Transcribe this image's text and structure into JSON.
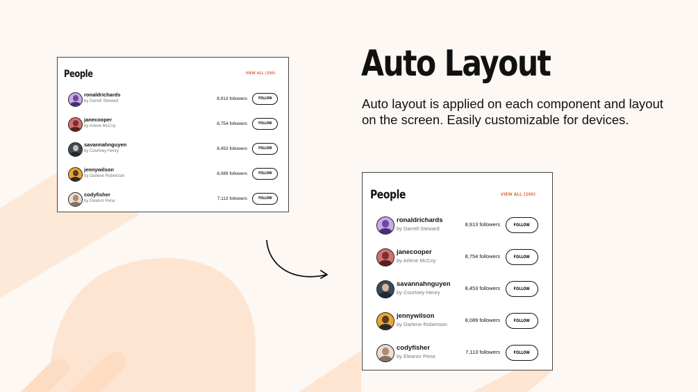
{
  "headline": "Auto Layout",
  "description": "Auto layout is applied on each component and layout on the screen. Easily customizable for devices.",
  "colors": {
    "background": "#fdf8f3",
    "accent": "#e2683c",
    "shape": "#fde5d2"
  },
  "card": {
    "title": "People",
    "view_all": "VIEW ALL (200)",
    "follow_label": "FOLLOW",
    "people": [
      {
        "username": "ronaldrichards",
        "byline": "by Darrell Steward",
        "followers": "8,913 followers",
        "avatar_bg": "#c9a9e6",
        "skin": "#6b4aa0",
        "shirt": "#4a2c7a"
      },
      {
        "username": "janecooper",
        "byline": "by Arlene McCoy",
        "followers": "8,754 followers",
        "avatar_bg": "#d47070",
        "skin": "#7a3030",
        "shirt": "#5a1e1e"
      },
      {
        "username": "savannahnguyen",
        "byline": "by Courtney Henry",
        "followers": "8,453 followers",
        "avatar_bg": "#3a4a58",
        "skin": "#d8b8a0",
        "shirt": "#1e2a34"
      },
      {
        "username": "jennywilson",
        "byline": "by Darlene Robertson",
        "followers": "8,089 followers",
        "avatar_bg": "#e8a830",
        "skin": "#5a3a28",
        "shirt": "#2a2a2a"
      },
      {
        "username": "codyfisher",
        "byline": "by Eleanor Pena",
        "followers": "7,113 followers",
        "avatar_bg": "#e8ddd4",
        "skin": "#b08a70",
        "shirt": "#8a7060"
      }
    ]
  }
}
